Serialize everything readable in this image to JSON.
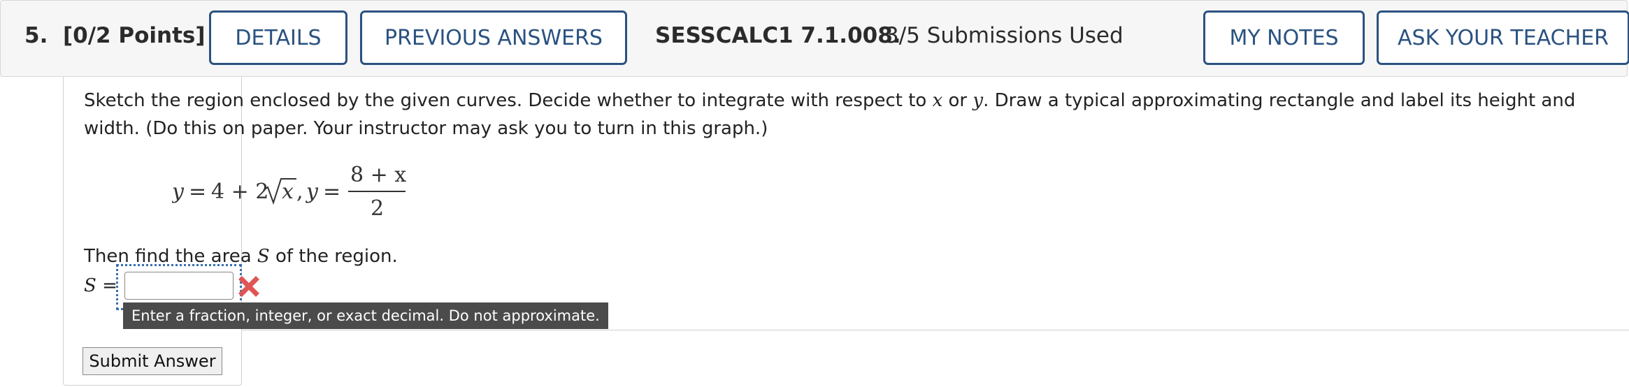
{
  "header": {
    "question_number": "5.",
    "points": "[0/2 Points]",
    "details_label": "DETAILS",
    "previous_answers_label": "PREVIOUS ANSWERS",
    "question_code": "SESSCALC1 7.1.008.",
    "submissions": "3/5 Submissions Used",
    "my_notes_label": "MY NOTES",
    "ask_teacher_label": "ASK YOUR TEACHER"
  },
  "question": {
    "prompt_part1": "Sketch the region enclosed by the given curves. Decide whether to integrate with respect to ",
    "var_x": "x",
    "prompt_or": " or ",
    "var_y": "y",
    "prompt_part2": ". Draw a typical approximating rectangle and label its height and width. (Do this on paper. Your instructor may ask you to turn in this graph.)",
    "formula": {
      "y1_lhs": "y",
      "equals": "=",
      "y1_rhs_const": "4 + 2",
      "sqrt_arg": "x",
      "comma": ",",
      "y2_lhs": "y",
      "numerator": "8 + x",
      "denominator": "2"
    },
    "find_text_part1": "Then find the area ",
    "find_var": "S",
    "find_text_part2": " of the region."
  },
  "answer": {
    "label_var": "S",
    "label_equals": " =",
    "value": "",
    "status_icon": "red-x-icon",
    "hint": "Enter a fraction, integer, or exact decimal. Do not approximate."
  },
  "actions": {
    "submit_label": "Submit Answer"
  },
  "colors": {
    "accent": "#2a5280",
    "incorrect": "#e05555",
    "tooltip_bg": "#4b4b4b"
  }
}
